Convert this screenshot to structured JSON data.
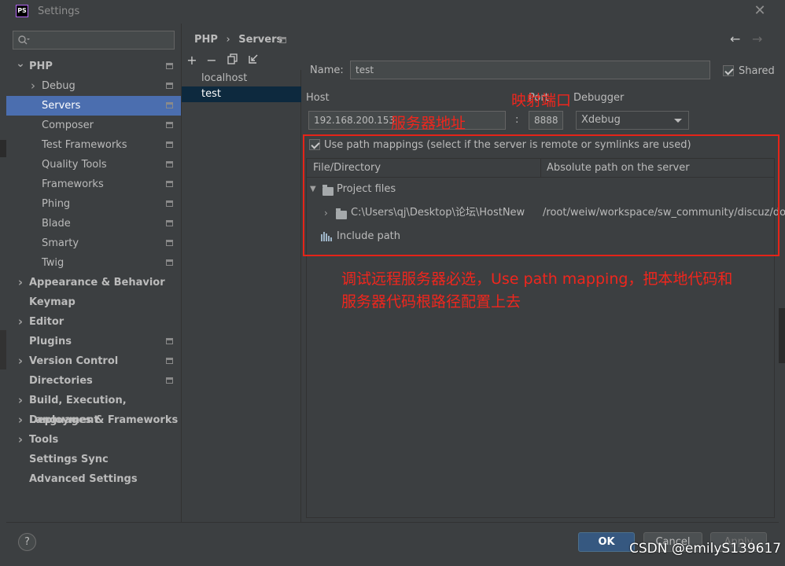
{
  "window": {
    "title": "Settings",
    "app_logo": "PS"
  },
  "sidebar": {
    "search_placeholder": "",
    "items": [
      {
        "label": "PHP",
        "bold": true,
        "arrow": "down"
      },
      {
        "label": "Debug",
        "arrow": "right"
      },
      {
        "label": "Servers",
        "selected": true
      },
      {
        "label": "Composer"
      },
      {
        "label": "Test Frameworks"
      },
      {
        "label": "Quality Tools"
      },
      {
        "label": "Frameworks"
      },
      {
        "label": "Phing"
      },
      {
        "label": "Blade"
      },
      {
        "label": "Smarty"
      },
      {
        "label": "Twig"
      },
      {
        "label": "Appearance & Behavior",
        "bold": true,
        "arrow": "right"
      },
      {
        "label": "Keymap",
        "bold": true
      },
      {
        "label": "Editor",
        "bold": true,
        "arrow": "right"
      },
      {
        "label": "Plugins",
        "bold": true
      },
      {
        "label": "Version Control",
        "bold": true,
        "arrow": "right"
      },
      {
        "label": "Directories",
        "bold": true
      },
      {
        "label": "Build, Execution, Deployment",
        "bold": true,
        "arrow": "right"
      },
      {
        "label": "Languages & Frameworks",
        "bold": true,
        "arrow": "right"
      },
      {
        "label": "Tools",
        "bold": true,
        "arrow": "right"
      },
      {
        "label": "Settings Sync",
        "bold": true
      },
      {
        "label": "Advanced Settings",
        "bold": true
      }
    ]
  },
  "breadcrumb": {
    "parent": "PHP",
    "sep": "›",
    "current": "Servers"
  },
  "servers": {
    "items": [
      "localhost",
      "test"
    ],
    "selected": "test"
  },
  "form": {
    "name_label": "Name:",
    "name_value": "test",
    "shared_label": "Shared",
    "host_label": "Host",
    "host_value": "192.168.200.153",
    "port_label": "Port",
    "port_sep": ":",
    "port_value": "8888",
    "debugger_label": "Debugger",
    "debugger_value": "Xdebug",
    "use_mappings_label": "Use path mappings (select if the server is remote or symlinks are used)"
  },
  "mappings": {
    "col_file": "File/Directory",
    "col_abs": "Absolute path on the server",
    "project_files": "Project files",
    "local_path": "C:\\Users\\qj\\Desktop\\论坛\\HostNew",
    "remote_path": "/root/weiw/workspace/sw_community/discuz/do...",
    "include_path": "Include path"
  },
  "annotations": {
    "server_addr": "服务器地址",
    "port_map": "映射端口",
    "note_line1": "调试远程服务器必选，Use path mapping，把本地代码和",
    "note_line2": "服务器代码根路径配置上去"
  },
  "buttons": {
    "help": "?",
    "ok": "OK",
    "cancel": "Cancel",
    "apply": "Apply"
  },
  "watermark": "CSDN @emilyS139617",
  "colors": {
    "selection": "#4b6eaf",
    "annotation": "#f0261d",
    "ok_button": "#365880"
  }
}
